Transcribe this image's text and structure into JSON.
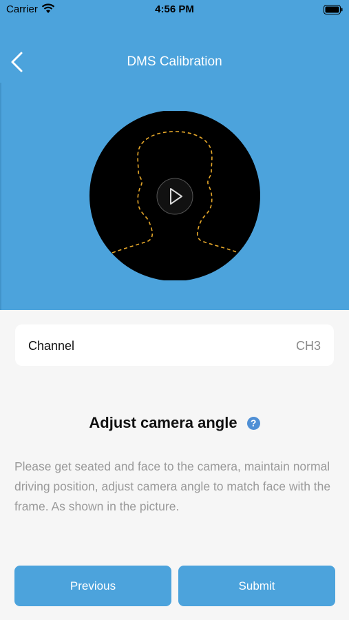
{
  "status_bar": {
    "carrier": "Carrier",
    "time": "4:56 PM"
  },
  "nav": {
    "title": "DMS Calibration",
    "back_icon": "chevron-left-icon"
  },
  "video": {
    "play_icon": "play-icon",
    "outline": "head-outline-dashed"
  },
  "channel": {
    "label": "Channel",
    "value": "CH3"
  },
  "instruction": {
    "title": "Adjust camera angle",
    "help_glyph": "?",
    "body": "Please get seated and face to the camera, maintain normal driving position, adjust camera angle to match face with the frame. As shown in the picture."
  },
  "buttons": {
    "previous": "Previous",
    "submit": "Submit"
  },
  "colors": {
    "accent": "#4ca3dc",
    "outline": "#e8a92a",
    "help": "#4f8fd5"
  }
}
